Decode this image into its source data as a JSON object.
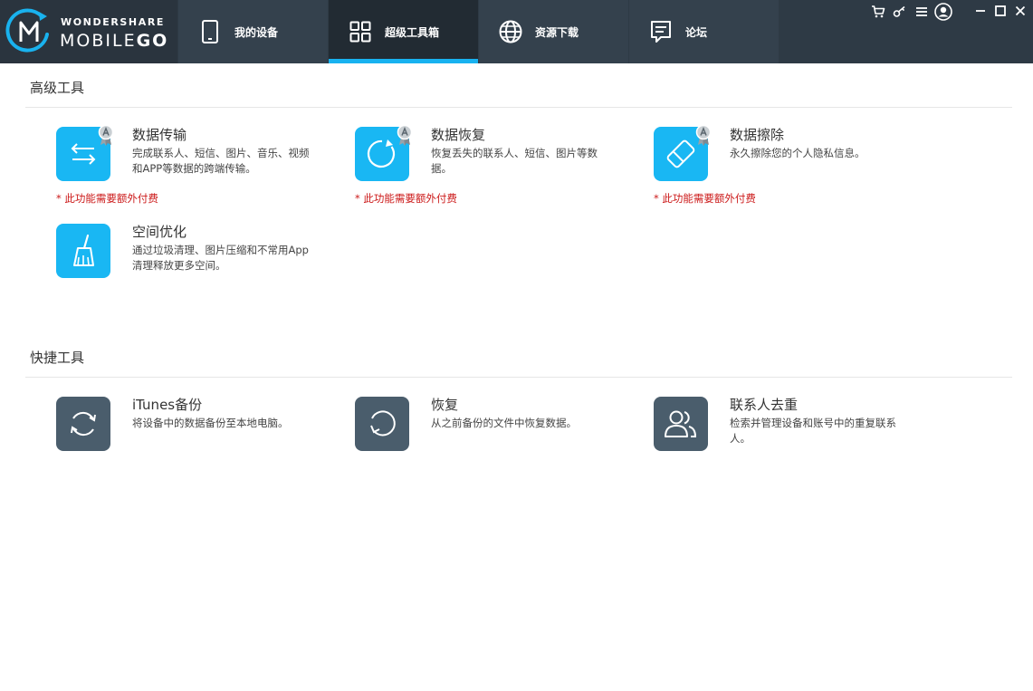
{
  "app": {
    "brand": "WONDERSHARE",
    "product_a": "MOBILE",
    "product_b": "GO"
  },
  "tabs": [
    {
      "label": "我的设备",
      "icon": "phone-icon",
      "active": false
    },
    {
      "label": "超级工具箱",
      "icon": "grid-icon",
      "active": true
    },
    {
      "label": "资源下载",
      "icon": "globe-icon",
      "active": false
    },
    {
      "label": "论坛",
      "icon": "forum-icon",
      "active": false
    }
  ],
  "toolbar_icons": [
    "cart-icon",
    "key-icon",
    "menu-icon",
    "user-icon"
  ],
  "window_controls": [
    "minimize-icon",
    "maximize-icon",
    "close-icon"
  ],
  "advanced": {
    "title": "高级工具",
    "paid_note": "* 此功能需要额外付费",
    "tools": [
      {
        "title": "数据传输",
        "desc": "完成联系人、短信、图片、音乐、视频和APP等数据的跨端传输。",
        "icon": "transfer-icon",
        "premium": true
      },
      {
        "title": "数据恢复",
        "desc": "恢复丢失的联系人、短信、图片等数据。",
        "icon": "recover-icon",
        "premium": true
      },
      {
        "title": "数据擦除",
        "desc": "永久擦除您的个人隐私信息。",
        "icon": "eraser-icon",
        "premium": true
      },
      {
        "title": "空间优化",
        "desc": "通过垃圾清理、图片压缩和不常用App清理释放更多空间。",
        "icon": "broom-icon",
        "premium": false
      }
    ]
  },
  "quick": {
    "title": "快捷工具",
    "tools": [
      {
        "title": "iTunes备份",
        "desc": "将设备中的数据备份至本地电脑。",
        "icon": "sync-icon"
      },
      {
        "title": "恢复",
        "desc": "从之前备份的文件中恢复数据。",
        "icon": "restore-icon"
      },
      {
        "title": "联系人去重",
        "desc": "检索并管理设备和账号中的重复联系人。",
        "icon": "contacts-icon"
      }
    ]
  },
  "colors": {
    "topbar": "#2e3a45",
    "accent": "#18b2f0",
    "tool_blue": "#19b7f3",
    "tool_slate": "#4a5d6c",
    "paid_red": "#cc1a1a"
  }
}
